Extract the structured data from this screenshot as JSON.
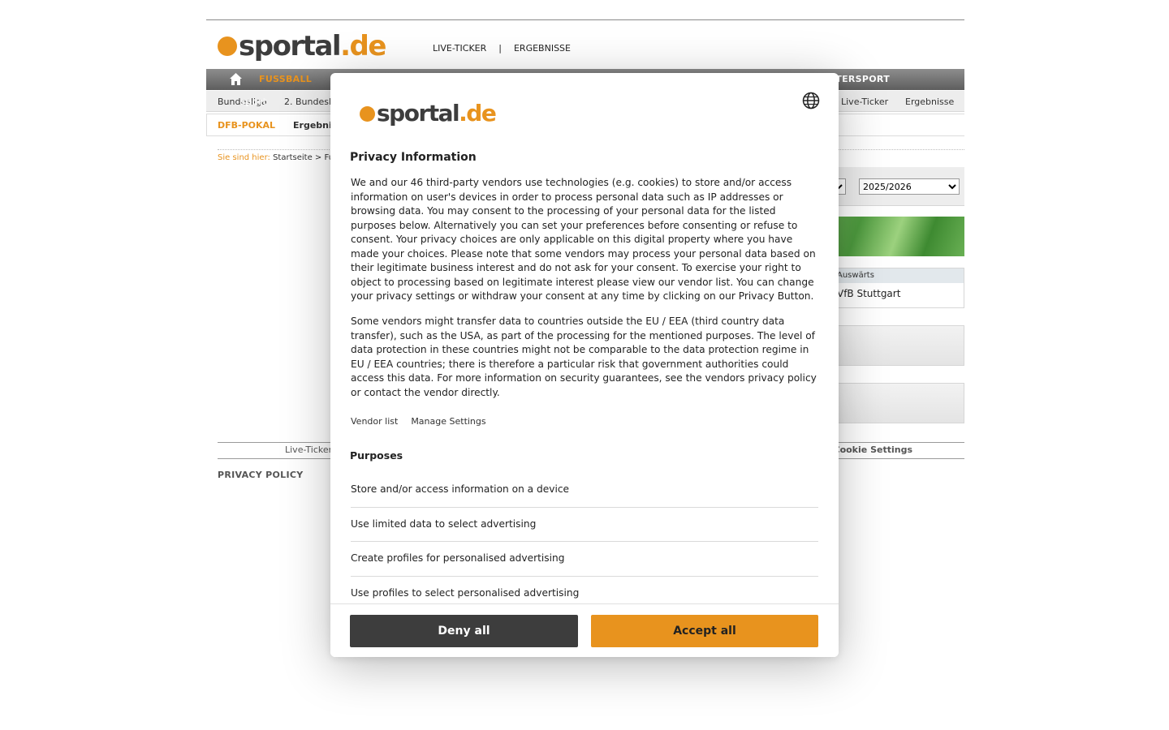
{
  "site": {
    "logo": {
      "main": "sportal",
      "accent": ".de"
    },
    "topnav": {
      "live_ticker": "LIVE-TICKER",
      "separator": "|",
      "results": "ERGEBNISSE"
    },
    "mainnav": {
      "fussball": "FUSSBALL",
      "motorsport": "TERSPORT"
    },
    "subnav": {
      "ghost_text": "sport",
      "items": [
        "Bundesliga",
        "2. Bundesli",
        "Live-Ticker",
        "Ergebnisse"
      ]
    },
    "cupnav": {
      "title": "DFB-POKAL",
      "results": "Ergebni"
    },
    "breadcrumb": {
      "label": "Sie sind hier:",
      "home": "Startseite",
      "separator": ">",
      "next": "Fu"
    },
    "season_select": {
      "selected": "2025/2026"
    },
    "match": {
      "header": "Auswärts",
      "team": "VfB Stuttgart"
    },
    "footer": {
      "live_ticker": "Live-Ticker",
      "cookie_settings": "Cookie Settings",
      "privacy_policy": "PRIVACY POLICY"
    },
    "colors": {
      "accent": "#e8931e",
      "nav_dark": "#5e5e5e"
    }
  },
  "consent": {
    "logo": {
      "main": "sportal",
      "accent": ".de"
    },
    "language_icon": "globe-icon",
    "title": "Privacy Information",
    "paragraph1": "We and our 46 third-party vendors use technologies (e.g. cookies) to store and/or access information on user's devices in order to process personal data such as IP addresses or browsing data. You may consent to the processing of your personal data for the listed purposes below. Alternatively you can set your preferences before consenting or refuse to consent. Your privacy choices are only applicable on this digital property where you have made your choices. Please note that some vendors may process your personal data based on their legitimate business interest and do not ask for your consent. To exercise your right to object to processing based on legitimate interest please view our vendor list. You can change your privacy settings or withdraw your consent at any time by clicking on our Privacy Button.",
    "paragraph2": "Some vendors might transfer data to countries outside the EU / EEA (third country data transfer), such as the USA, as part of the processing for the mentioned purposes. The level of data protection in these countries might not be comparable to the data protection regime in EU / EEA countries; there is therefore a particular risk that government authorities could access this data. For more information on security guarantees, see the vendors privacy policy or contact the vendor directly.",
    "vendor_list": "Vendor list",
    "manage_settings": "Manage Settings",
    "purposes_title": "Purposes",
    "purposes": [
      "Store and/or access information on a device",
      "Use limited data to select advertising",
      "Create profiles for personalised advertising",
      "Use profiles to select personalised advertising"
    ],
    "deny_label": "Deny all",
    "accept_label": "Accept all"
  }
}
